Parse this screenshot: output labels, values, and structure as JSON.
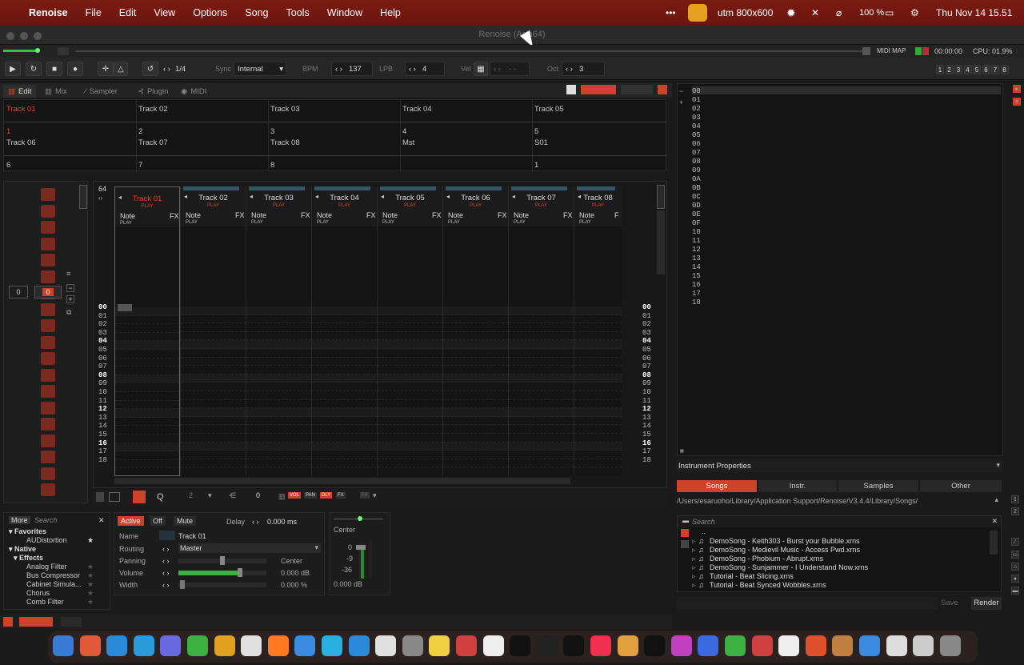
{
  "menubar": {
    "app_name": "Renoise",
    "items": [
      "File",
      "Edit",
      "View",
      "Options",
      "Song",
      "Tools",
      "Window",
      "Help"
    ],
    "status": {
      "vm": "utm 800x600",
      "battery": "100 %",
      "datetime": "Thu Nov 14  15.51"
    }
  },
  "window": {
    "title": "Renoise (Arm64)"
  },
  "topbar": {
    "midi_map": "MIDI MAP",
    "time": "00:00:00",
    "cpu": "CPU: 01.9%"
  },
  "transport": {
    "loop_value": "1/4",
    "sync_label": "Sync",
    "sync_value": "Internal",
    "bpm_label": "BPM",
    "bpm_value": "137",
    "lpb_label": "LPB",
    "lpb_value": "4",
    "vel_label": "Vel",
    "vel_value": "- -",
    "oct_label": "Oct",
    "oct_value": "3",
    "tracks_numbers": [
      "1",
      "2",
      "3",
      "4",
      "5",
      "6",
      "7",
      "8"
    ]
  },
  "tabs": {
    "edit": "Edit",
    "mix": "Mix",
    "sampler": "Sampler",
    "plugin": "Plugin",
    "midi": "MIDI"
  },
  "tracklist": {
    "row1": [
      "Track 01",
      "Track 02",
      "Track 03",
      "Track 04",
      "Track 05"
    ],
    "row1_nums": [
      "1",
      "2",
      "3",
      "4",
      "5"
    ],
    "row2": [
      "Track 06",
      "Track 07",
      "Track 08",
      "Mst",
      "S01"
    ],
    "row2_nums": [
      "6",
      "7",
      "8",
      "",
      "1"
    ]
  },
  "leftmatrix": {
    "a": "0",
    "b": "0"
  },
  "pattern": {
    "length": "64",
    "columns": [
      {
        "name": "Track 01",
        "play": "PLAY",
        "note": "Note",
        "fx": "FX",
        "sub": "PLAY"
      },
      {
        "name": "Track 02",
        "play": "PLAY",
        "note": "Note",
        "fx": "FX",
        "sub": "PLAY"
      },
      {
        "name": "Track 03",
        "play": "PLAY",
        "note": "Note",
        "fx": "FX",
        "sub": "PLAY"
      },
      {
        "name": "Track 04",
        "play": "PLAY",
        "note": "Note",
        "fx": "FX",
        "sub": "PLAY"
      },
      {
        "name": "Track 05",
        "play": "PLAY",
        "note": "Note",
        "fx": "FX",
        "sub": "PLAY"
      },
      {
        "name": "Track 06",
        "play": "PLAY",
        "note": "Note",
        "fx": "FX",
        "sub": "PLAY"
      },
      {
        "name": "Track 07",
        "play": "PLAY",
        "note": "Note",
        "fx": "FX",
        "sub": "PLAY"
      },
      {
        "name": "Track 08",
        "play": "PLAY",
        "note": "Note",
        "fx": "F",
        "sub": "PLAY"
      }
    ],
    "rows": [
      "00",
      "01",
      "02",
      "03",
      "04",
      "05",
      "06",
      "07",
      "08",
      "09",
      "10",
      "11",
      "12",
      "13",
      "14",
      "15",
      "16",
      "17",
      "18"
    ],
    "bottom": {
      "q_value": "2",
      "step_value": "0",
      "vol": "VOL",
      "pan": "PAN",
      "dly": "DLY",
      "fx": "FX"
    }
  },
  "instruments": {
    "slots": [
      "00",
      "01",
      "02",
      "03",
      "04",
      "05",
      "06",
      "07",
      "08",
      "09",
      "0A",
      "0B",
      "0C",
      "0D",
      "0E",
      "0F",
      "10",
      "11",
      "12",
      "13",
      "14",
      "15",
      "16",
      "17",
      "18"
    ],
    "properties_label": "Instrument Properties"
  },
  "disk_browser": {
    "tabs": [
      "Songs",
      "Instr.",
      "Samples",
      "Other"
    ],
    "path": "/Users/esaruoho/Library/Application Support/Renoise/V3.4.4/Library/Songs/",
    "search_placeholder": "Search",
    "up": "..",
    "files": [
      "DemoSong - Keith303 - Burst your Bubble.xrns",
      "DemoSong - Medievil Music - Access Pwd.xrns",
      "DemoSong - Phobium - Abrupt.xrns",
      "DemoSong - Sunjammer - I Understand Now.xrns",
      "Tutorial - Beat Slicing.xrns",
      "Tutorial - Beat Synced Wobbles.xrns"
    ],
    "save": "Save",
    "render": "Render"
  },
  "dsp_browser": {
    "more": "More",
    "search_placeholder": "Search",
    "tree": [
      {
        "label": "Favorites",
        "level": 0
      },
      {
        "label": "AUDistortion",
        "level": 2
      },
      {
        "label": "Native",
        "level": 0
      },
      {
        "label": "Effects",
        "level": 1
      },
      {
        "label": "Analog Filter",
        "level": 2
      },
      {
        "label": "Bus Compressor",
        "level": 2
      },
      {
        "label": "Cabinet Simula...",
        "level": 2
      },
      {
        "label": "Chorus",
        "level": 2
      },
      {
        "label": "Comb Filter",
        "level": 2
      }
    ]
  },
  "track_device": {
    "active": "Active",
    "off": "Off",
    "mute": "Mute",
    "delay_label": "Delay",
    "delay_value": "0.000 ms",
    "name_label": "Name",
    "name_value": "Track 01",
    "routing_label": "Routing",
    "routing_value": "Master",
    "panning_label": "Panning",
    "panning_value": "Center",
    "volume_label": "Volume",
    "volume_value": "0.000 dB",
    "width_label": "Width",
    "width_value": "0.000 %"
  },
  "mixer": {
    "pan": "Center",
    "scale": [
      "0",
      "-9",
      "-36"
    ],
    "db": "0.000 dB"
  },
  "colors": {
    "accent": "#e2442a",
    "menubar": "#7a1a10",
    "bg": "#1a1a1a"
  }
}
